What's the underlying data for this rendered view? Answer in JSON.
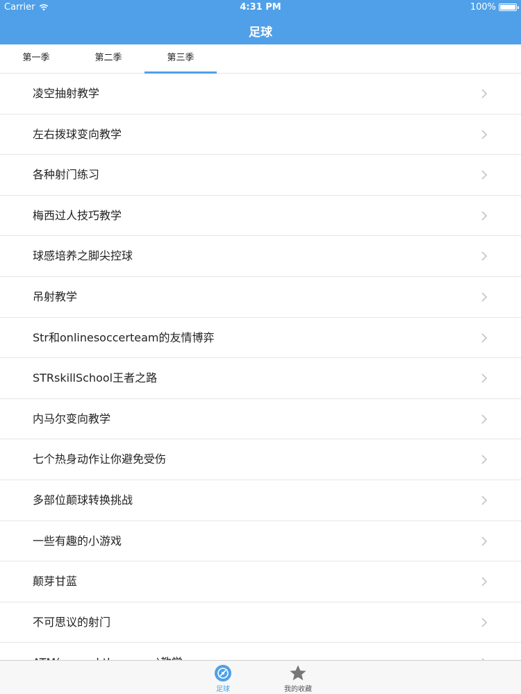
{
  "status_bar": {
    "carrier": "Carrier",
    "time": "4:31 PM",
    "battery": "100%",
    "battery_level": 1.0,
    "wifi_icon": "wifi-icon"
  },
  "nav": {
    "title": "足球"
  },
  "tabs": [
    {
      "label": "第一季",
      "selected": false
    },
    {
      "label": "第二季",
      "selected": false
    },
    {
      "label": "第三季",
      "selected": true
    }
  ],
  "list": {
    "items": [
      {
        "label": "凌空抽射教学"
      },
      {
        "label": "左右拨球变向教学"
      },
      {
        "label": "各种射门练习"
      },
      {
        "label": "梅西过人技巧教学"
      },
      {
        "label": "球感培养之脚尖控球"
      },
      {
        "label": "吊射教学"
      },
      {
        "label": "Str和onlinesoccerteam的友情博弈"
      },
      {
        "label": "STRskillSchool王者之路"
      },
      {
        "label": "内马尔变向教学"
      },
      {
        "label": "七个热身动作让你避免受伤"
      },
      {
        "label": "多部位颠球转换挑战"
      },
      {
        "label": "一些有趣的小游戏"
      },
      {
        "label": "颠芽甘蓝"
      },
      {
        "label": "不可思议的射门"
      },
      {
        "label": "ATM(around the moon)教学"
      }
    ],
    "row_icon": "chevron-right-icon"
  },
  "tabbar": {
    "items": [
      {
        "label": "足球",
        "icon": "soccer-ball-icon",
        "active": true
      },
      {
        "label": "我的收藏",
        "icon": "star-icon",
        "active": false
      }
    ]
  },
  "colors": {
    "accent": "#4fa0e8",
    "nav_text": "#ffffff",
    "separator": "#e6e6e6",
    "chevron": "#c7c7cc",
    "inactive_icon": "#777777"
  }
}
